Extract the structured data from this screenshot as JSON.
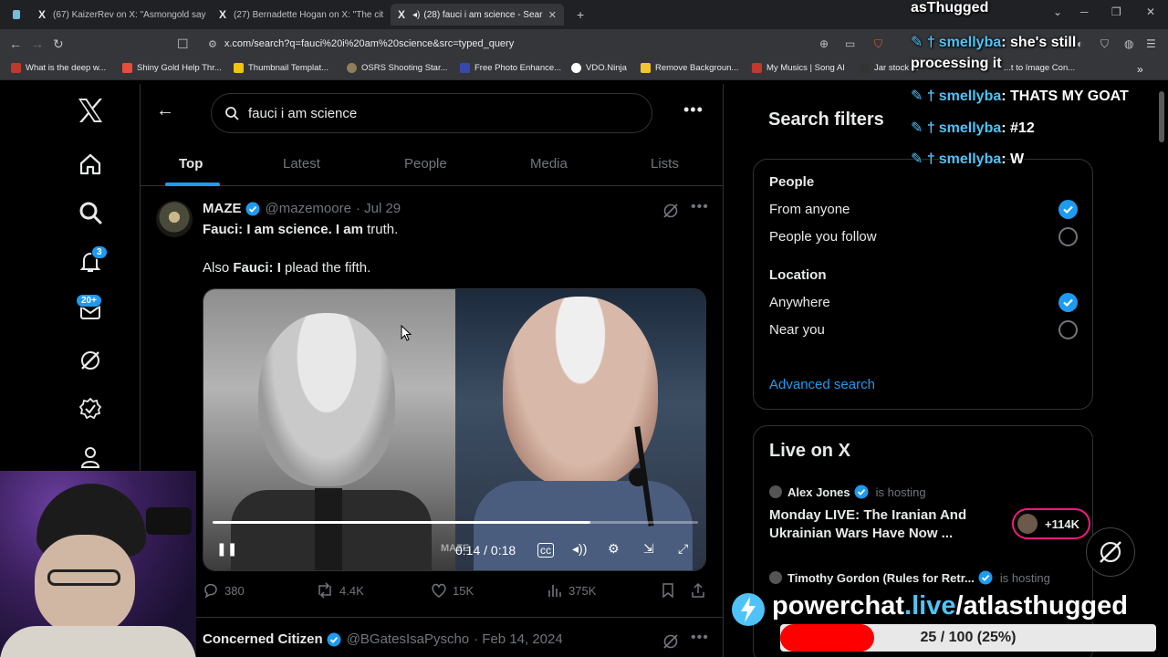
{
  "browser": {
    "tabs": [
      {
        "label": "(67) KaizerRev on X: \"Asmongold say"
      },
      {
        "label": "(27) Bernadette Hogan on X: \"The cit"
      },
      {
        "label": "(28) fauci i am science - Sear"
      }
    ],
    "new_tab": "+",
    "url": "x.com/search?q=fauci%20i%20am%20science&src=typed_query",
    "bookmarks": [
      {
        "label": "What is the deep w...",
        "color": "#c0392b"
      },
      {
        "label": "Shiny Gold Help Thr...",
        "color": "#e74c3c"
      },
      {
        "label": "Thumbnail Templat...",
        "color": "#f1c40f"
      },
      {
        "label": "OSRS Shooting Star...",
        "color": "#8e7f5a"
      },
      {
        "label": "Free Photo Enhance...",
        "color": "#3949ab"
      },
      {
        "label": "VDO.Ninja",
        "color": "#ffffff"
      },
      {
        "label": "Remove Backgroun...",
        "color": "#f4c430"
      },
      {
        "label": "My Musics | Song AI",
        "color": "#c0392b"
      },
      {
        "label": "Jar stock ...",
        "color": "#333333"
      }
    ],
    "bookmark_extra": "...t to Image Con..."
  },
  "leftnav": {
    "notifications_badge": "3",
    "messages_badge": "20+"
  },
  "search": {
    "query": "fauci i am science",
    "tabs": [
      "Top",
      "Latest",
      "People",
      "Media",
      "Lists"
    ]
  },
  "posts": [
    {
      "name": "MAZE",
      "handle": "@mazemoore",
      "date": "· Jul 29",
      "line1_bold": "Fauci: I am science. I am",
      "line1_rest": " truth.",
      "line2_pre": "Also ",
      "line2_bold": "Fauci: I",
      "line2_rest": " plead the fifth.",
      "video": {
        "time": "0:14 / 0:18",
        "progress": 0.77778,
        "watermark": "MAZE"
      },
      "replies": "380",
      "reposts": "4.4K",
      "likes": "15K",
      "views": "375K"
    },
    {
      "name": "Concerned Citizen",
      "handle": "@BGatesIsaPyscho",
      "date": "· Feb 14, 2024"
    }
  ],
  "filters": {
    "title": "Search filters",
    "people_heading": "People",
    "people_options": [
      {
        "label": "From anyone",
        "selected": true
      },
      {
        "label": "People you follow",
        "selected": false
      }
    ],
    "location_heading": "Location",
    "location_options": [
      {
        "label": "Anywhere",
        "selected": true
      },
      {
        "label": "Near you",
        "selected": false
      }
    ],
    "advanced": "Advanced search"
  },
  "live": {
    "title": "Live on X",
    "items": [
      {
        "host": "Alex Jones",
        "status": "is hosting",
        "title": "Monday LIVE: The Iranian And Ukrainian Wars Have Now ...",
        "count": "+114K"
      },
      {
        "host": "Timothy Gordon (Rules for Retr...",
        "status": "is hosting"
      }
    ]
  },
  "overlay": {
    "chat_header": "asThugged",
    "chat": [
      {
        "user": "smellyba",
        "msg": "she's still"
      },
      {
        "user": "",
        "msg": "processing it"
      },
      {
        "user": "smellyba",
        "msg": "THATS MY GOAT"
      },
      {
        "user": "smellyba",
        "msg": "#12"
      },
      {
        "user": "smellyba",
        "msg": "W"
      }
    ],
    "powerchat_prefix": "powerchat",
    "powerchat_live": ".live",
    "powerchat_suffix": "/atlasthugged",
    "goal_label": "25 / 100 (25%)",
    "goal_progress": 0.25
  },
  "colors": {
    "accent": "#1d9bf0",
    "live_ring": "#f91880",
    "goal_fill": "#ff0000"
  }
}
